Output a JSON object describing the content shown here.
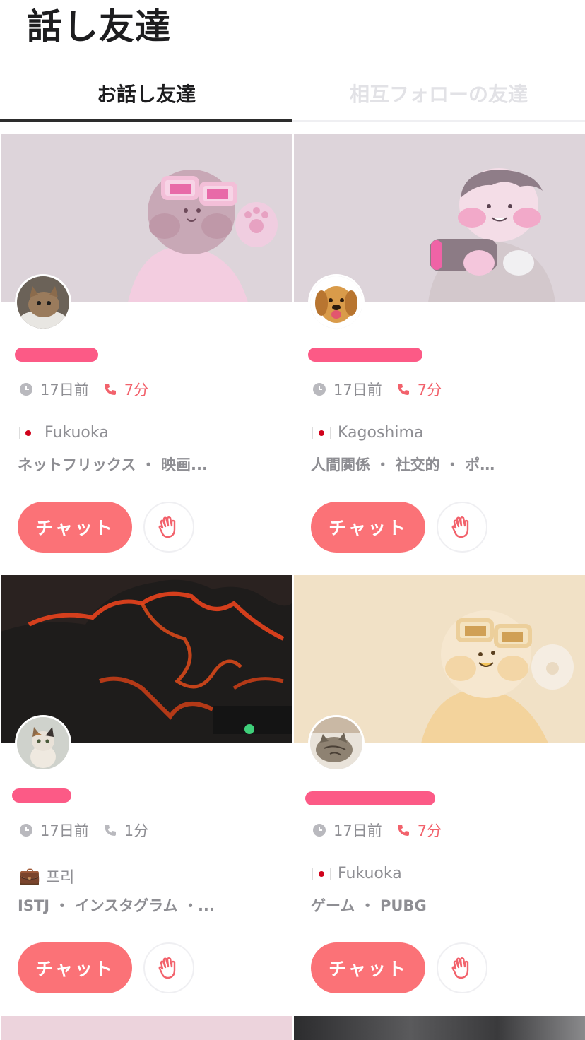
{
  "page": {
    "title": "話し友達"
  },
  "tabs": [
    {
      "label": "お話し友達",
      "active": true
    },
    {
      "label": "相互フォローの友達",
      "active": false
    }
  ],
  "cards": [
    {
      "last_seen": "17日前",
      "duration": "7分",
      "duration_color": "#f2626c",
      "location": "Fukuoka",
      "location_icon": "japan-flag-icon",
      "interests": "ネットフリックス ・ 映画...",
      "chat_label": "チャット"
    },
    {
      "last_seen": "17日前",
      "duration": "7分",
      "duration_color": "#f2626c",
      "location": "Kagoshima",
      "location_icon": "japan-flag-icon",
      "interests": "人間関係 ・ 社交的 ・ ポ…",
      "chat_label": "チャット"
    },
    {
      "last_seen": "17日前",
      "duration": "1分",
      "duration_color": "#8e8e93",
      "location": "프리",
      "location_icon": "briefcase-icon",
      "interests": "ISTJ ・ インスタグラム ・...",
      "chat_label": "チャット"
    },
    {
      "last_seen": "17日前",
      "duration": "7分",
      "duration_color": "#f2626c",
      "location": "Fukuoka",
      "location_icon": "japan-flag-icon",
      "interests": "ゲーム ・ PUBG",
      "chat_label": "チャット"
    }
  ],
  "colors": {
    "accent": "#fb7277",
    "name_redaction": "#fc5a86",
    "muted_text": "#8e8e93"
  }
}
